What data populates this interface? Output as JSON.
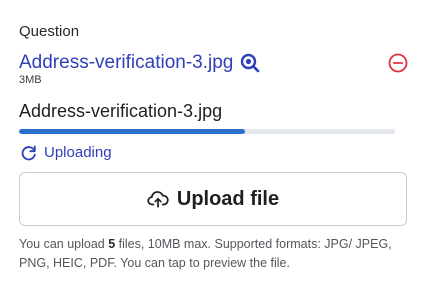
{
  "field": {
    "label": "Question"
  },
  "attached_file": {
    "name": "Address-verification-3.jpg",
    "size": "3MB",
    "preview_icon": "zoom-icon",
    "remove_icon": "minus-circle-icon"
  },
  "upload": {
    "file_name": "Address-verification-3.jpg",
    "progress": 0.6,
    "status": "Uploading",
    "status_icon": "refresh-icon"
  },
  "upload_button": {
    "label": "Upload file",
    "icon": "cloud-upload-icon"
  },
  "help": {
    "prefix": "You can upload ",
    "count": "5",
    "suffix": " files, 10MB max. Supported formats: JPG/ JPEG, PNG, HEIC, PDF. You can tap to preview the file."
  },
  "colors": {
    "link": "#2f3fb8",
    "progress": "#2a6fc9",
    "track": "#e3e6eb",
    "remove": "#e0303e"
  }
}
